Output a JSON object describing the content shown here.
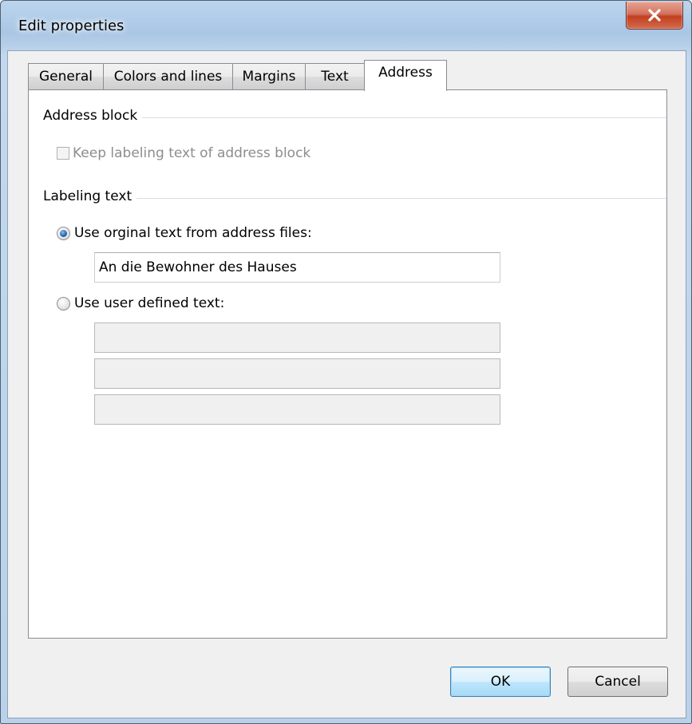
{
  "window": {
    "title": "Edit properties",
    "close_label": "x"
  },
  "tabs": [
    {
      "label": "General",
      "active": false
    },
    {
      "label": "Colors and lines",
      "active": false
    },
    {
      "label": "Margins",
      "active": false
    },
    {
      "label": "Text",
      "active": false
    },
    {
      "label": "Address",
      "active": true
    }
  ],
  "address_block": {
    "group_label": "Address block",
    "keep_label_checkbox": {
      "label": "Keep labeling text of address block",
      "checked": false,
      "enabled": false
    }
  },
  "labeling_text": {
    "group_label": "Labeling text",
    "original_option": {
      "label": "Use orginal text from address files:",
      "selected": true,
      "value": "An die Bewohner des Hauses"
    },
    "user_option": {
      "label": "Use user defined text:",
      "selected": false,
      "lines": [
        "",
        "",
        ""
      ]
    }
  },
  "buttons": {
    "ok": "OK",
    "cancel": "Cancel"
  },
  "colors": {
    "title_bar": "#a9c6e4",
    "close_button": "#c1401f",
    "default_button": "#bee6fd",
    "radio_selected": "#2e6fb4"
  }
}
